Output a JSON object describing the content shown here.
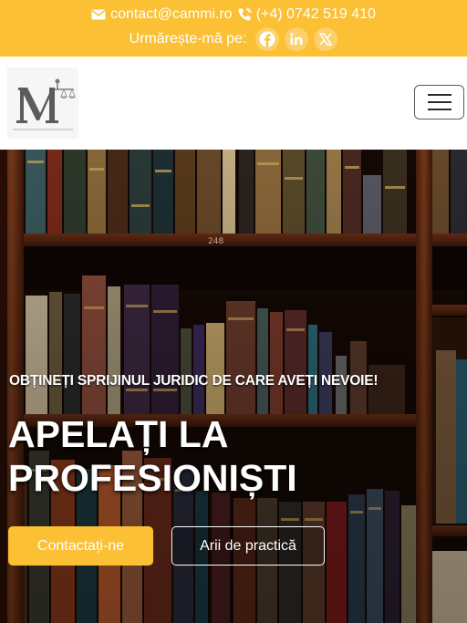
{
  "topbar": {
    "email": "contact@cammi.ro",
    "phone": "(+4) 0742 519 410",
    "follow_label": "Urmărește-mă pe:",
    "icons": [
      "envelope-icon",
      "phone-icon",
      "facebook-icon",
      "linkedin-icon",
      "x-icon"
    ],
    "bg_color": "#fbc033"
  },
  "header": {
    "logo_icon": "justice-scale-logo",
    "menu_icon": "hamburger-icon"
  },
  "hero": {
    "eyebrow": "OBȚINEȚI SPRIJINUL JURIDIC DE CARE AVEȚI NEVOIE!",
    "headline_line1": "APELAȚI LA",
    "headline_line2": "PROFESIONIȘTI",
    "primary_button": "Contactați-ne",
    "secondary_button": "Arii de practică",
    "shelf_number": "248",
    "accent_color": "#fbc033"
  }
}
